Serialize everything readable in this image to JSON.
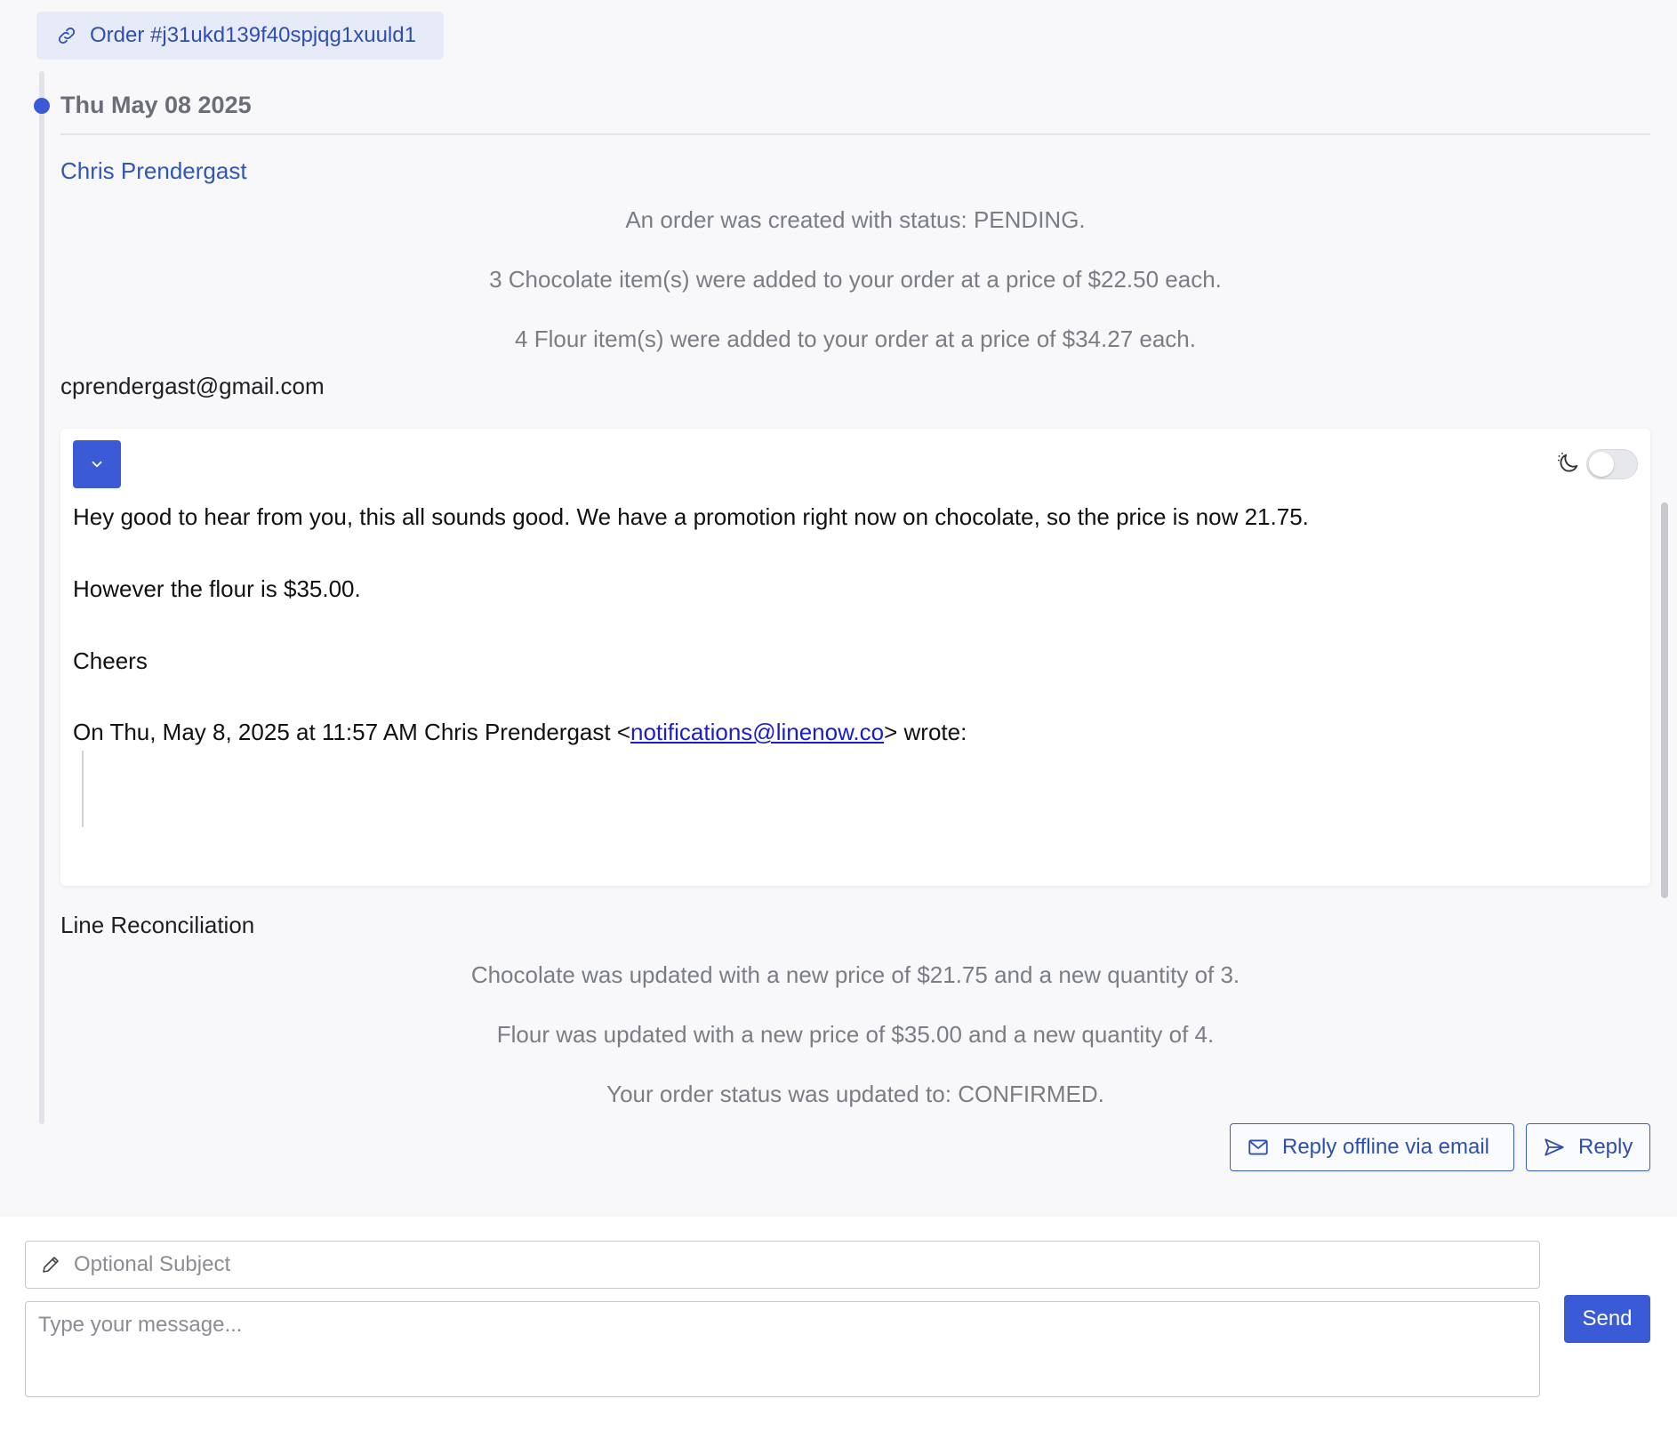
{
  "order_tag": {
    "label": "Order #j31ukd139f40spjqg1xuuld1"
  },
  "thread": {
    "date": "Thu May 08 2025",
    "author": "Chris Prendergast",
    "events_before": [
      "An order was created with status: PENDING.",
      "3 Chocolate item(s) were added to your order at a price of $22.50 each.",
      "4 Flour item(s) were added to your order at a price of $34.27 each."
    ],
    "email_sender": "cprendergast@gmail.com",
    "email": {
      "line1": "Hey good to hear from you, this all sounds good. We have a promotion right now on chocolate, so the price is now 21.75.",
      "line2": "However the flour is $35.00.",
      "line3": "Cheers",
      "quote_prefix": "On Thu, May 8, 2025 at 11:57 AM Chris Prendergast <",
      "quote_link": "notifications@linenow.co",
      "quote_suffix": "> wrote:"
    },
    "section_title": "Line Reconciliation",
    "events_after": [
      "Chocolate was updated with a new price of $21.75 and a new quantity of 3.",
      "Flour was updated with a new price of $35.00 and a new quantity of 4.",
      "Your order status was updated to: CONFIRMED."
    ]
  },
  "actions": {
    "reply_offline_label": "Reply offline via email",
    "reply_label": "Reply"
  },
  "composer": {
    "subject_placeholder": "Optional Subject",
    "message_placeholder": "Type your message...",
    "send_label": "Send"
  },
  "colors": {
    "accent": "#3b5bd6",
    "link": "#2f57b8",
    "muted_text": "#7a7d84"
  }
}
